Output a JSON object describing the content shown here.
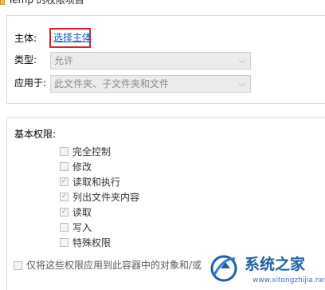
{
  "window": {
    "title": "Temp 的权限项目"
  },
  "principal": {
    "label": "主体:",
    "link": "选择主体"
  },
  "type": {
    "label": "类型:",
    "value": "允许"
  },
  "applies_to": {
    "label": "应用于:",
    "value": "此文件夹、子文件夹和文件"
  },
  "basic_permissions": {
    "heading": "基本权限:",
    "items": [
      {
        "label": "完全控制",
        "checked": false
      },
      {
        "label": "修改",
        "checked": false
      },
      {
        "label": "读取和执行",
        "checked": true
      },
      {
        "label": "列出文件夹内容",
        "checked": true
      },
      {
        "label": "读取",
        "checked": true
      },
      {
        "label": "写入",
        "checked": false
      },
      {
        "label": "特殊权限",
        "checked": false
      }
    ]
  },
  "apply_only": {
    "label": "仅将这些权限应用到此容器中的对象和/或",
    "checked": false
  },
  "watermark": {
    "brand": "系统之家",
    "url": "www.xitongzhijia.net"
  },
  "colors": {
    "highlight": "#d9252a",
    "link": "#0a5ec4",
    "brand": "#1f5fa8"
  }
}
